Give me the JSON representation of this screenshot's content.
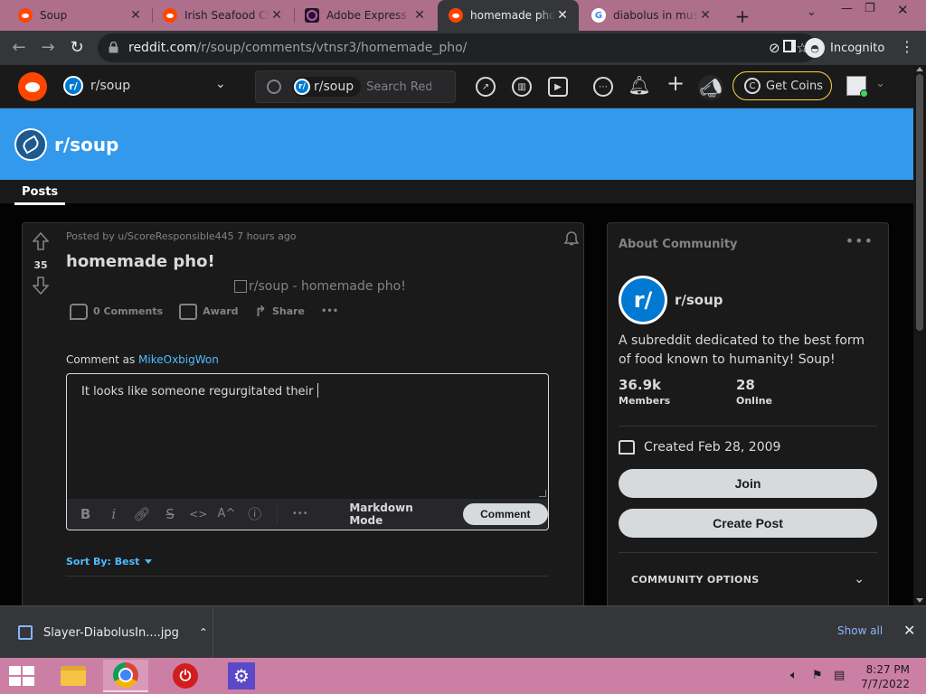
{
  "browser": {
    "tabs": [
      {
        "title": "Soup",
        "favicon": "reddit-icon",
        "active": false
      },
      {
        "title": "Irish Seafood Chowder",
        "favicon": "reddit-icon",
        "active": false
      },
      {
        "title": "Adobe Express (free)",
        "favicon": "adobe-express-icon",
        "active": false
      },
      {
        "title": "homemade pho! : soup",
        "favicon": "reddit-icon",
        "active": true
      },
      {
        "title": "diabolus in musica",
        "favicon": "google-icon",
        "active": false
      }
    ],
    "url_host": "reddit.com",
    "url_path": "/r/soup/comments/vtnsr3/homemade_pho/",
    "profile_label": "Incognito"
  },
  "reddit_header": {
    "subreddit": "r/soup",
    "subreddit_icon_text": "r/",
    "search_scope": "r/soup",
    "search_placeholder": "Search Reddit",
    "get_coins": "Get Coins"
  },
  "banner": {
    "name": "r/soup"
  },
  "tabs": {
    "posts": "Posts"
  },
  "post": {
    "score": "35",
    "meta": "Posted by u/ScoreResponsible445 7 hours ago",
    "title": "homemade pho!",
    "image_alt": "r/soup - homemade pho!",
    "actions": {
      "comments": "0 Comments",
      "award": "Award",
      "share": "Share",
      "more": "•••"
    },
    "comment_as_prefix": "Comment as",
    "username": "MikeOxbigWon",
    "draft_text": "It looks like someone regurgitated their",
    "toolbar": {
      "bold": "B",
      "italic": "i",
      "superscript": "A^",
      "more": "•••",
      "markdown_mode": "Markdown Mode",
      "comment_button": "Comment"
    },
    "sort_by": "Sort By: Best"
  },
  "sidebar": {
    "heading": "About Community",
    "more": "•••",
    "icon_text": "r/",
    "name": "r/soup",
    "description": "A subreddit dedicated to the best form of food known to humanity! Soup!",
    "members_count": "36.9k",
    "members_label": "Members",
    "online_count": "28",
    "online_label": "Online",
    "created": "Created Feb 28, 2009",
    "join_button": "Join",
    "create_post_button": "Create Post",
    "community_options": "COMMUNITY OPTIONS"
  },
  "downloads": {
    "file_name": "Slayer-DiabolusIn....jpg",
    "show_all": "Show all"
  },
  "taskbar": {
    "time": "8:27 PM",
    "date": "7/7/2022"
  }
}
